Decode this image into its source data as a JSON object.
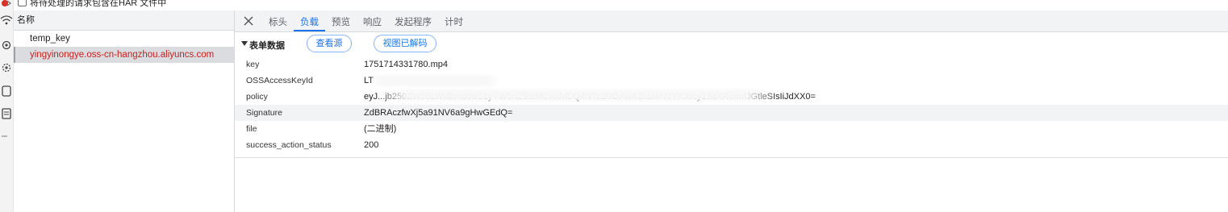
{
  "har": {
    "checkbox_label": "将待处理的请求包含在HAR 文件中"
  },
  "list": {
    "header": "名称",
    "items": [
      {
        "label": "temp_key",
        "selected": false
      },
      {
        "label": "yingyinongye.oss-cn-hangzhou.aliyuncs.com",
        "selected": true
      }
    ]
  },
  "tabs": {
    "items": [
      {
        "label": "标头",
        "active": false
      },
      {
        "label": "负载",
        "active": true
      },
      {
        "label": "预览",
        "active": false
      },
      {
        "label": "响应",
        "active": false
      },
      {
        "label": "发起程序",
        "active": false
      },
      {
        "label": "计时",
        "active": false
      }
    ]
  },
  "form_section": {
    "title": "表单数据",
    "view_source_label": "查看源",
    "view_decoded_label": "视图已解码",
    "rows": [
      {
        "key": "key",
        "value": "1751714331780.mp4",
        "highlighted": false
      },
      {
        "key": "OSSAccessKeyId",
        "value": "LT",
        "highlighted": false
      },
      {
        "key": "policy",
        "value": "eyJ...jb250ZW50LWxlbmd0aC1yYW5nZSIsMCwxMDQ4NTc2MDAwXSxbInN0YXJ0cy13aXRoIiwiJGtleSIsIiJdXX0=",
        "highlighted": false
      },
      {
        "key": "Signature",
        "value": "ZdBRAczfwXj5a91NV6a9gHwGEdQ=",
        "highlighted": true
      },
      {
        "key": "file",
        "value": "(二进制)",
        "highlighted": false
      },
      {
        "key": "success_action_status",
        "value": "200",
        "highlighted": false
      }
    ]
  },
  "colors": {
    "accent": "#1a73e8",
    "selected_text": "#c5221f",
    "panel_bg": "#f1f3f4"
  },
  "icons": [
    "record-icon",
    "wifi-icon",
    "gear-icon",
    "device-icon",
    "document-icon",
    "dash-icon",
    "close-icon",
    "triangle-down-icon"
  ]
}
